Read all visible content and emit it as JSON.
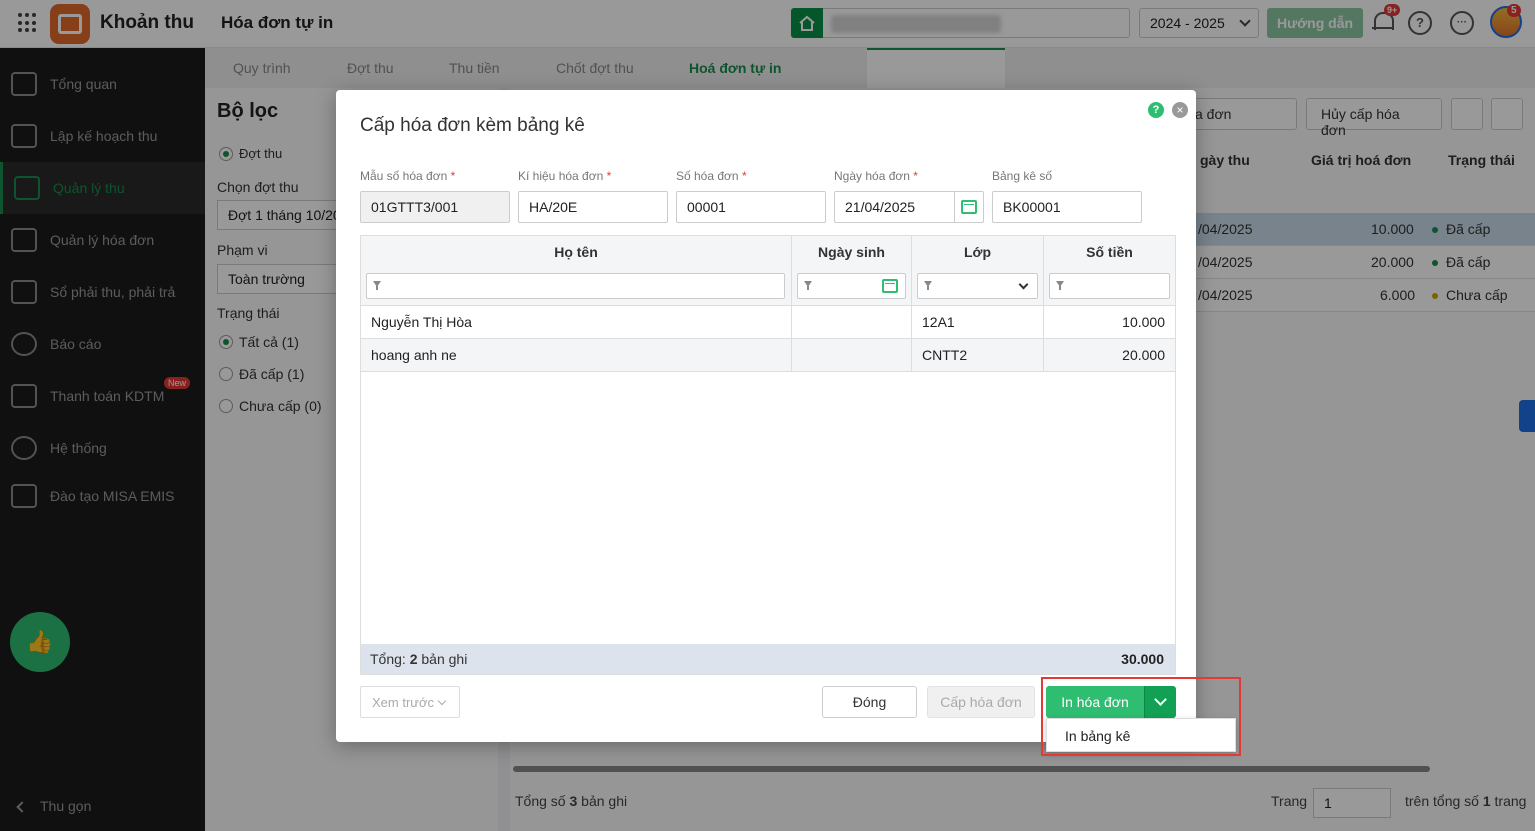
{
  "header": {
    "app_name": "Khoản thu",
    "page_title": "Hóa đơn tự in",
    "year": "2024 - 2025",
    "guide_label": "Hướng dẫn",
    "notif_count": "9+",
    "avatar_badge": "5",
    "help_symbol": "?",
    "more_symbol": "···"
  },
  "sidebar": {
    "items": [
      {
        "label": "Tổng quan",
        "icon": "chart-bars-icon"
      },
      {
        "label": "Lập kế hoạch thu",
        "icon": "calendar-money-icon"
      },
      {
        "label": "Quản lý thu",
        "icon": "money-hand-icon"
      },
      {
        "label": "Quản lý hóa đơn",
        "icon": "document-icon"
      },
      {
        "label": "Sổ phải thu, phải trả",
        "icon": "ledger-icon"
      },
      {
        "label": "Báo cáo",
        "icon": "pie-chart-icon"
      },
      {
        "label": "Thanh toán KDTM",
        "icon": "card-check-icon"
      },
      {
        "label": "Hệ thống",
        "icon": "gear-icon"
      },
      {
        "label": "Đào tạo MISA EMIS",
        "icon": "book-icon"
      }
    ],
    "active_index": 2,
    "new_badge": "New",
    "collapse_label": "Thu gọn"
  },
  "tabs": [
    "Quy trình",
    "Đợt thu",
    "Thu tiền",
    "Chốt đợt thu",
    "Hoá đơn tự in"
  ],
  "filter": {
    "title": "Bộ lọc",
    "mode_option": "Đợt thu",
    "period_label": "Chọn đợt thu",
    "period_value": "Đợt 1 tháng 10/202",
    "scope_label": "Phạm vi",
    "scope_value": "Toàn trường",
    "status_label": "Trạng thái",
    "status_options": [
      "Tất cả (1)",
      "Đã cấp (1)",
      "Chưa cấp (0)"
    ]
  },
  "main": {
    "partial_btn": "a đơn",
    "cancel_btn": "Hủy cấp hóa đơn",
    "columns": [
      "gày thu",
      "Giá trị hoá đơn",
      "Trạng thái"
    ],
    "rows": [
      {
        "date": "/04/2025",
        "value": "10.000",
        "status": "Đã cấp",
        "color": "#188d4d"
      },
      {
        "date": "/04/2025",
        "value": "20.000",
        "status": "Đã cấp",
        "color": "#188d4d"
      },
      {
        "date": "/04/2025",
        "value": "6.000",
        "status": "Chưa cấp",
        "color": "#d4a300"
      }
    ],
    "total_prefix": "Tổng số",
    "total_count": "3",
    "total_suffix": "bản ghi",
    "page_label": "Trang",
    "page_value": "1",
    "page_total_prefix": "trên tổng số",
    "page_total": "1",
    "page_total_suffix": "trang"
  },
  "modal": {
    "title": "Cấp hóa đơn kèm bảng kê",
    "help_symbol": "?",
    "close_symbol": "×",
    "fields": {
      "template_label": "Mẫu số hóa đơn",
      "template_value": "01GTTT3/001",
      "symbol_label": "Kí hiệu hóa đơn",
      "symbol_value": "HA/20E",
      "number_label": "Số hóa đơn",
      "number_value": "00001",
      "date_label": "Ngày hóa đơn",
      "date_value": "21/04/2025",
      "list_label": "Bảng kê số",
      "list_value": "BK00001",
      "required_mark": "*"
    },
    "grid": {
      "columns": [
        "Họ tên",
        "Ngày sinh",
        "Lớp",
        "Số tiền"
      ],
      "rows": [
        {
          "name": "Nguyễn Thị Hòa",
          "dob": "",
          "class": "12A1",
          "amount": "10.000"
        },
        {
          "name": "hoang anh ne",
          "dob": "",
          "class": "CNTT2",
          "amount": "20.000"
        }
      ],
      "total_prefix": "Tổng:",
      "total_count": "2",
      "total_suffix": "bản ghi",
      "total_amount": "30.000"
    },
    "buttons": {
      "preview": "Xem trước",
      "close": "Đóng",
      "issue": "Cấp hóa đơn",
      "print": "In hóa đơn"
    },
    "dropdown_item": "In bảng kê"
  },
  "colors": {
    "brand_green": "#188d4d",
    "primary_button": "#2ebd71",
    "highlight": "#e53935"
  }
}
